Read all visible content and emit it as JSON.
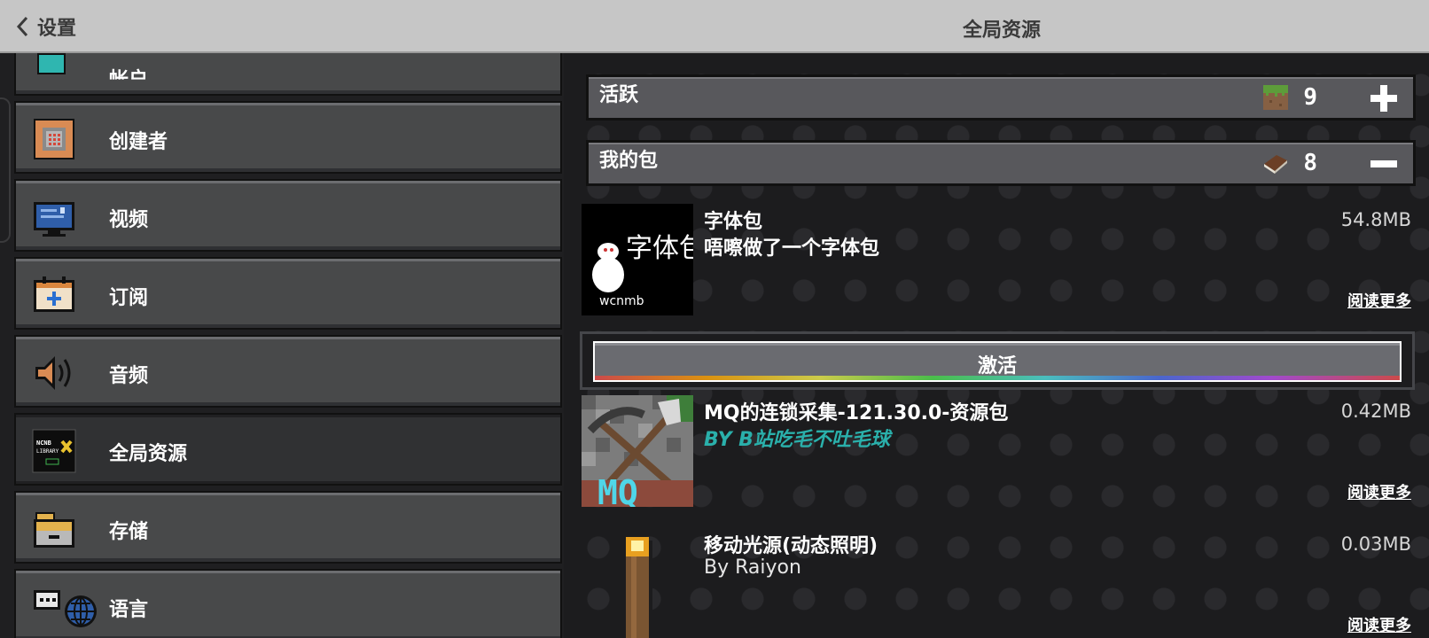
{
  "header": {
    "back_label": "设置",
    "title": "全局资源"
  },
  "sidebar": {
    "items": [
      {
        "label": "帐户",
        "icon": "account-icon"
      },
      {
        "label": "创建者",
        "icon": "creator-icon"
      },
      {
        "label": "视频",
        "icon": "video-icon"
      },
      {
        "label": "订阅",
        "icon": "subscription-icon"
      },
      {
        "label": "音频",
        "icon": "audio-icon"
      },
      {
        "label": "全局资源",
        "icon": "global-resources-icon",
        "active": true,
        "icon_text": "NCNB LIBRARY"
      },
      {
        "label": "存储",
        "icon": "storage-icon"
      },
      {
        "label": "语言",
        "icon": "language-icon"
      }
    ]
  },
  "sections": {
    "active": {
      "title": "活跃",
      "count": "9",
      "icon": "grass-block-icon",
      "toggle": "plus-icon"
    },
    "my_packs": {
      "title": "我的包",
      "count": "8",
      "icon": "book-icon",
      "toggle": "minus-icon"
    }
  },
  "packs": [
    {
      "title": "字体包",
      "description": "唔嚓做了一个字体包",
      "size": "54.8MB",
      "read_more": "阅读更多",
      "thumb_text": "字体包",
      "thumb_caption": "wcnmb"
    },
    {
      "title": "MQ的连锁采集-121.30.0-资源包",
      "description": "BY B站吃毛不吐毛球",
      "size": "0.42MB",
      "read_more": "阅读更多",
      "thumb_text": "MQ"
    },
    {
      "title": "移动光源(动态照明)",
      "description": "By Raiyon",
      "size": "0.03MB",
      "read_more": "阅读更多"
    }
  ],
  "activate_button": {
    "label": "激活"
  },
  "colors": {
    "accent_teal": "#2ab0ab",
    "panel": "#48494a",
    "topbar": "#c6c6c6"
  }
}
